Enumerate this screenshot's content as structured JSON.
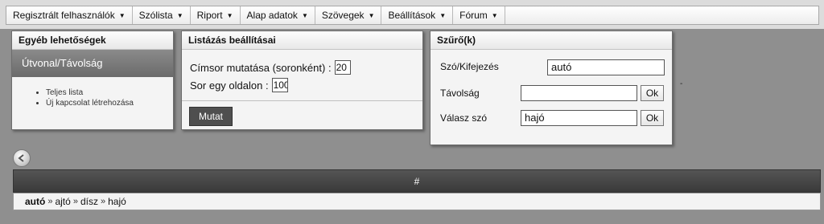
{
  "menu": {
    "items": [
      {
        "label": "Regisztrált felhasználók"
      },
      {
        "label": "Szólista"
      },
      {
        "label": "Riport"
      },
      {
        "label": "Alap adatok"
      },
      {
        "label": "Szövegek"
      },
      {
        "label": "Beállítások"
      },
      {
        "label": "Fórum"
      }
    ]
  },
  "other_options": {
    "title": "Egyéb lehetőségek",
    "route_label": "Útvonal/Távolság",
    "links": [
      "Teljes lista",
      "Új kapcsolat létrehozása"
    ]
  },
  "listing": {
    "title": "Listázás beállításai",
    "header_label": "Címsor mutatása (soronként) :",
    "header_value": "20",
    "perpage_label": "Sor egy oldalon :",
    "perpage_value": "100",
    "submit_label": "Mutat"
  },
  "filter": {
    "title": "Szűrő(k)",
    "word_label": "Szó/Kifejezés",
    "word_value": "autó",
    "distance_label": "Távolság",
    "distance_value": "",
    "distance_ok": "Ok",
    "answer_label": "Válasz szó",
    "answer_value": "hajó",
    "answer_ok": "Ok"
  },
  "separator_text": "-",
  "table": {
    "header": "#",
    "chain": [
      "autó",
      "ajtó",
      "dísz",
      "hajó"
    ],
    "chain_separator": "»"
  },
  "icons": {
    "menu_caret": "caret-down-icon",
    "back": "back-arrow-icon",
    "bullet": "bullet-icon"
  }
}
